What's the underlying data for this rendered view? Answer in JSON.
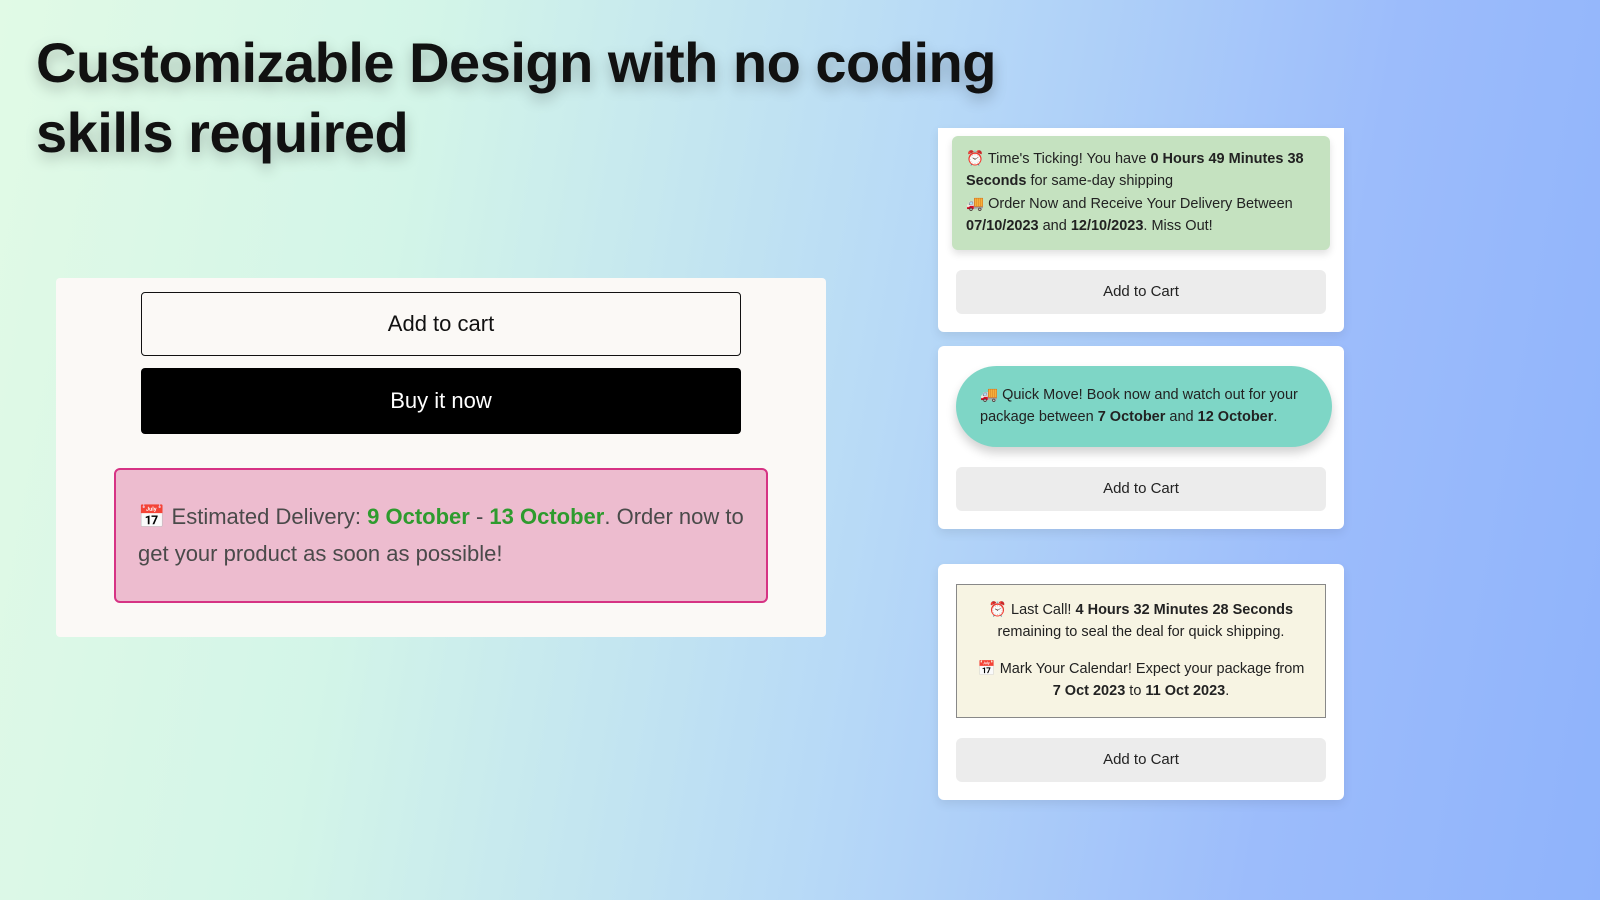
{
  "title": "Customizable Design with no coding skills required",
  "bigCard": {
    "addToCart": "Add to cart",
    "buyNow": "Buy it now",
    "banner": {
      "icon": "📅",
      "prefix": "Estimated Delivery: ",
      "date1": "9 October",
      "dash": " - ",
      "date2": "13 October",
      "suffix": ". Order now to get your product as soon as possible!"
    }
  },
  "card1": {
    "clockIcon": "⏰",
    "line1a": "Time's Ticking! You have ",
    "line1b": "0 Hours 49 Minutes 38 Seconds",
    "line1c": " for same-day shipping",
    "truckIcon": "🚚",
    "line2a": "Order Now and Receive Your Delivery Between ",
    "line2b": "07/10/2023",
    "line2c": " and ",
    "line2d": "12/10/2023",
    "line2e": ". Miss Out!",
    "addToCart": "Add to Cart"
  },
  "card2": {
    "truckIcon": "🚚",
    "line1a": "Quick Move! Book now and watch out for your package between ",
    "line1b": "7 October",
    "line1c": " and ",
    "line1d": "12 October",
    "line1e": ".",
    "addToCart": "Add to Cart"
  },
  "card3": {
    "clockIcon": "⏰",
    "line1a": "Last Call! ",
    "line1b": "4 Hours 32 Minutes 28 Seconds",
    "line1c": " remaining to seal the deal for quick shipping.",
    "calIcon": "📅",
    "line2a": "Mark Your Calendar! Expect your package from ",
    "line2b": "7 Oct 2023",
    "line2c": " to ",
    "line2d": "11 Oct 2023",
    "line2e": ".",
    "addToCart": "Add to Cart"
  }
}
